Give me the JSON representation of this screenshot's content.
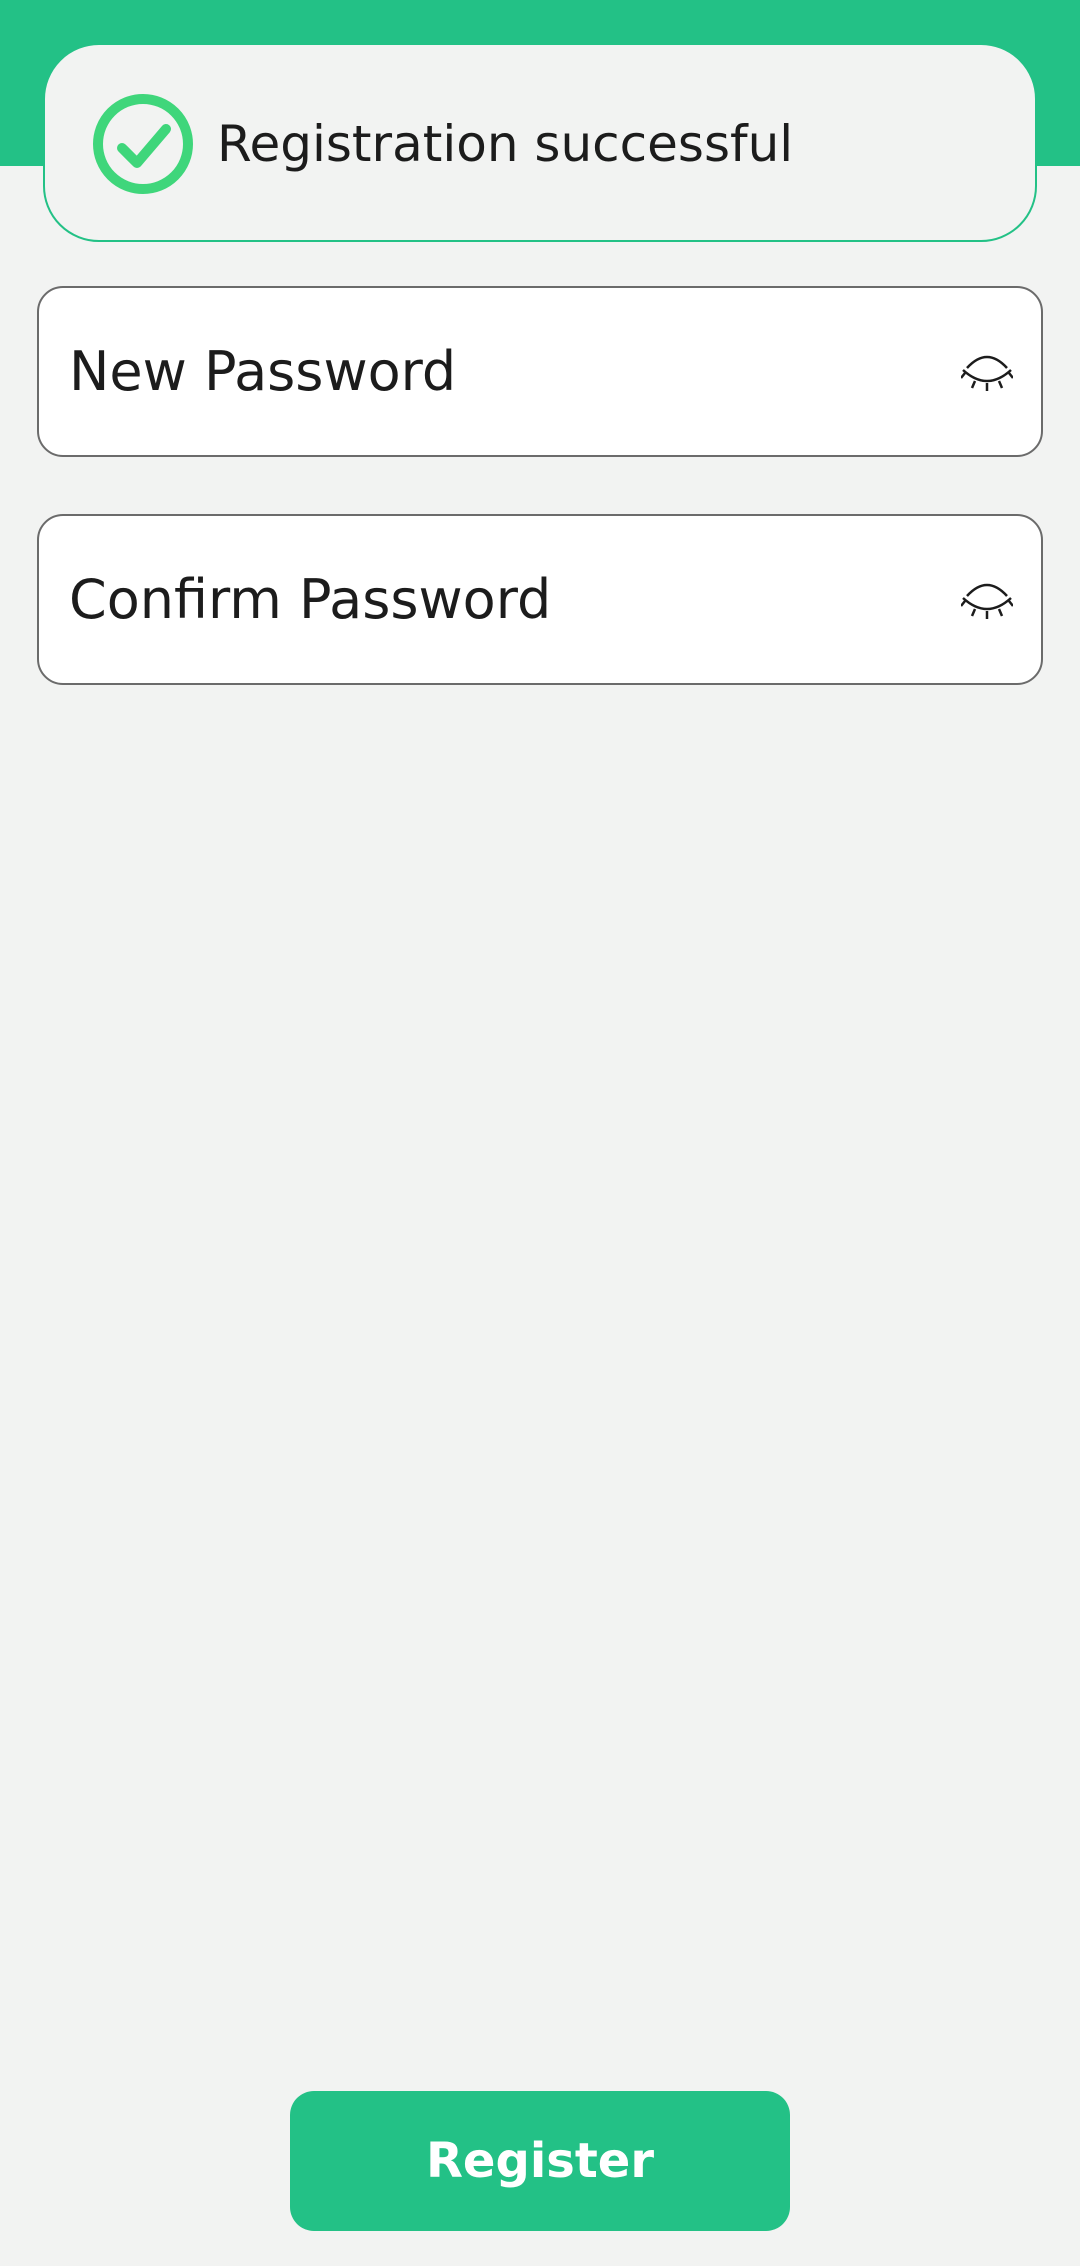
{
  "colors": {
    "accent": "#23c186",
    "success_icon": "#3fd67b",
    "background": "#f2f3f2",
    "text": "#1c1c1c",
    "field_border": "#6b6b6b"
  },
  "toast": {
    "icon": "check-circle-icon",
    "message": "Registration successful"
  },
  "form": {
    "new_password": {
      "value": "",
      "placeholder": "New Password",
      "toggle_icon": "eye-closed-icon"
    },
    "confirm_password": {
      "value": "",
      "placeholder": "Confirm Password",
      "toggle_icon": "eye-closed-icon"
    }
  },
  "actions": {
    "register_label": "Register"
  }
}
